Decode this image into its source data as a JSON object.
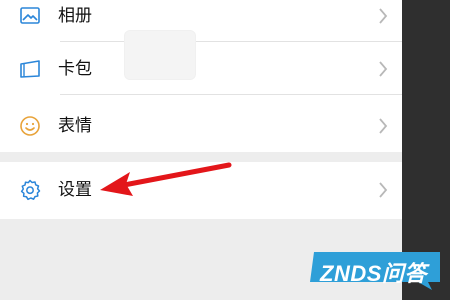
{
  "menu": {
    "items": [
      {
        "label": "相册",
        "icon": "album-icon"
      },
      {
        "label": "卡包",
        "icon": "cards-icon"
      },
      {
        "label": "表情",
        "icon": "sticker-icon"
      }
    ],
    "settings": {
      "label": "设置",
      "icon": "settings-icon"
    }
  },
  "colors": {
    "accent": "#2b86d9",
    "sticker": "#e8a33a",
    "arrow": "#e3161a",
    "background": "#ededed",
    "watermark": "#2e9fd8"
  },
  "watermark": {
    "text": "ZNDS问答"
  }
}
